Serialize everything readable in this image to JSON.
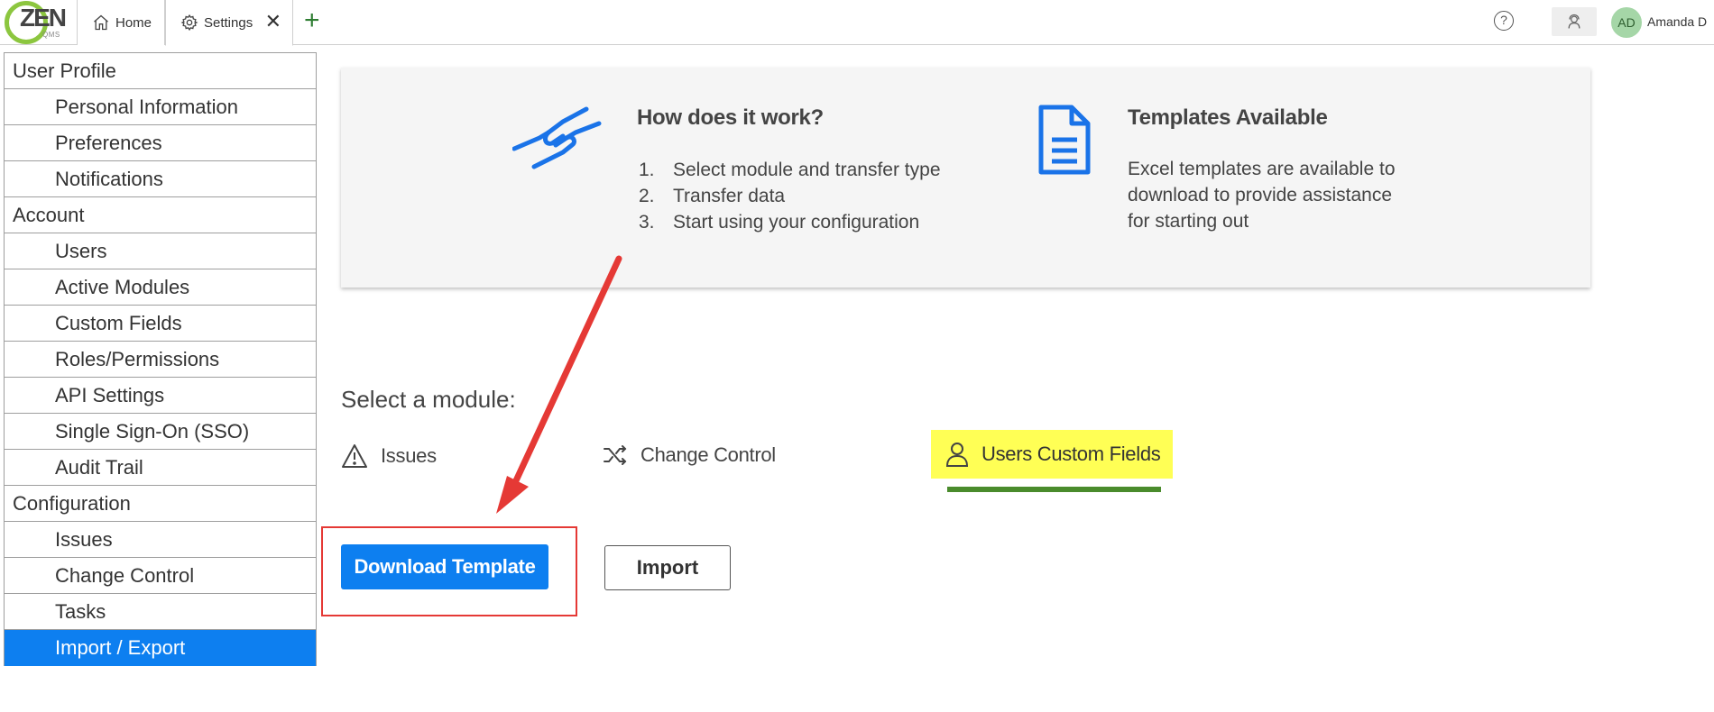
{
  "app": {
    "logo_text": "ZEN",
    "logo_sub": "QMS"
  },
  "tabs": [
    {
      "label": "Home",
      "icon": "home-icon"
    },
    {
      "label": "Settings",
      "icon": "gear-icon",
      "close_icon": "close-icon"
    }
  ],
  "header": {
    "add_tab": "+",
    "help": "?",
    "avatar_initials": "AD",
    "user_name": "Amanda D"
  },
  "sidebar": {
    "sections": [
      {
        "label": "User Profile",
        "items": [
          "Personal Information",
          "Preferences",
          "Notifications"
        ]
      },
      {
        "label": "Account",
        "items": [
          "Users",
          "Active Modules",
          "Custom Fields",
          "Roles/Permissions",
          "API Settings",
          "Single Sign-On (SSO)",
          "Audit Trail"
        ]
      },
      {
        "label": "Configuration",
        "items": [
          "Issues",
          "Change Control",
          "Tasks",
          "Import / Export"
        ]
      }
    ],
    "active_item": "Import / Export"
  },
  "info_card": {
    "how_title": "How does it work?",
    "steps": [
      {
        "num": "1.",
        "text": "Select module and transfer type"
      },
      {
        "num": "2.",
        "text": "Transfer data"
      },
      {
        "num": "3.",
        "text": "Start using your configuration"
      }
    ],
    "templates_title": "Templates Available",
    "templates_desc": "Excel templates are available to download to provide assistance for starting out"
  },
  "modules": {
    "label": "Select a module:",
    "items": [
      {
        "label": "Issues",
        "icon": "warning-icon"
      },
      {
        "label": "Change Control",
        "icon": "shuffle-icon"
      },
      {
        "label": "Users Custom Fields",
        "icon": "user-icon"
      }
    ],
    "selected": "Users Custom Fields"
  },
  "actions": {
    "download_label": "Download Template",
    "import_label": "Import"
  },
  "colors": {
    "primary": "#0d7ff0",
    "highlight": "#ffff55",
    "active_underline": "#4a8b2c",
    "annotation": "#e53935"
  }
}
